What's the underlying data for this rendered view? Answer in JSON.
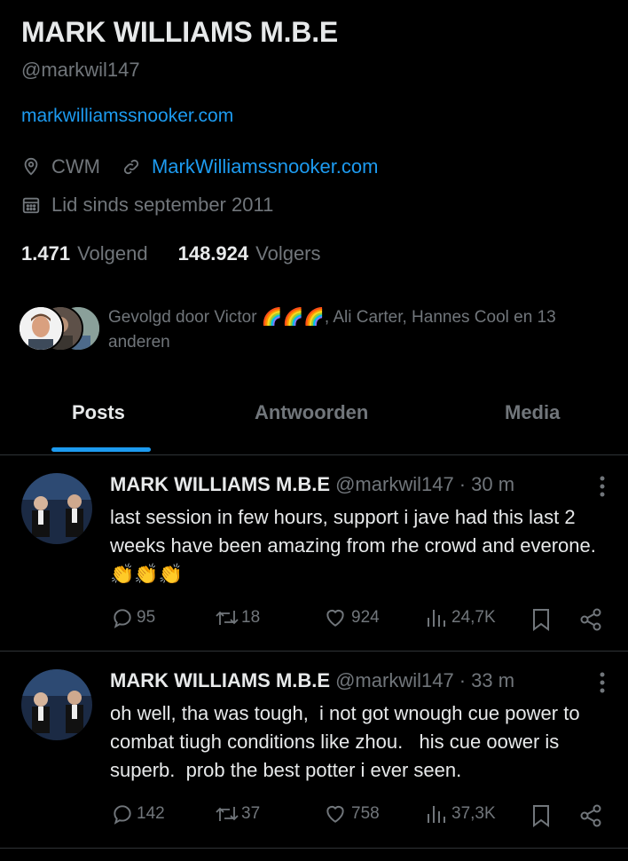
{
  "profile": {
    "name": "MARK WILLIAMS M.B.E",
    "handle": "@markwil147",
    "bio_link": "markwilliamssnooker.com",
    "location": "CWM",
    "website": "MarkWilliamssnooker.com",
    "joined": "Lid sinds september 2011",
    "following_count": "1.471",
    "following_label": "Volgend",
    "followers_count": "148.924",
    "followers_label": "Volgers",
    "followed_by": "Gevolgd door Victor 🌈🌈🌈, Ali Carter, Hannes Cool en 13 anderen"
  },
  "tabs": [
    {
      "label": "Posts",
      "active": true
    },
    {
      "label": "Antwoorden",
      "active": false
    },
    {
      "label": "Media",
      "active": false
    }
  ],
  "posts": [
    {
      "name": "MARK WILLIAMS M.B.E",
      "handle": "@markwil147",
      "time": "· 30 m",
      "text": "last session in few hours, support i jave had this last 2 weeks have been amazing from rhe crowd and everone. 👏👏👏",
      "replies": "95",
      "reposts": "18",
      "likes": "924",
      "views": "24,7K"
    },
    {
      "name": "MARK WILLIAMS M.B.E",
      "handle": "@markwil147",
      "time": "· 33 m",
      "text": "oh well, tha was tough,  i not got wnough cue power to combat tiugh conditions like zhou.   his cue oower is superb.  prob the best potter i ever seen.",
      "replies": "142",
      "reposts": "37",
      "likes": "758",
      "views": "37,3K"
    }
  ],
  "colors": {
    "background": "#000000",
    "text": "#e7e9ea",
    "muted": "#71767b",
    "accent": "#1d9bf0",
    "divider": "#2f3336"
  },
  "icons": [
    "location-icon",
    "link-icon",
    "calendar-icon",
    "reply-icon",
    "repost-icon",
    "like-icon",
    "views-icon",
    "bookmark-icon",
    "share-icon",
    "more-icon"
  ]
}
